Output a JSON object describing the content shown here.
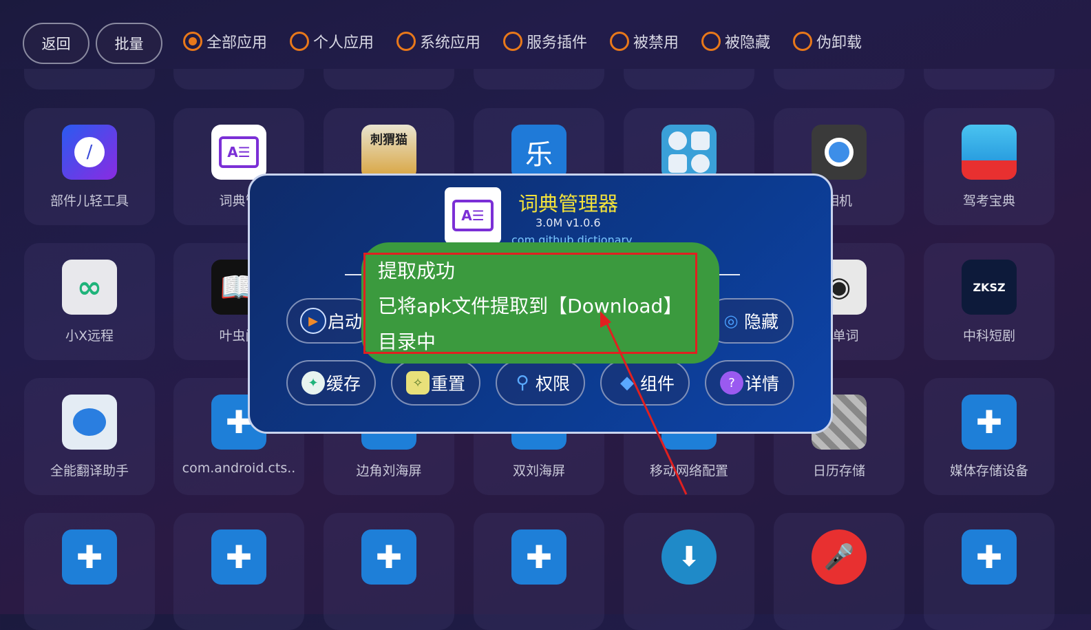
{
  "topbar": {
    "back_label": "返回",
    "batch_label": "批量",
    "filters": [
      {
        "label": "全部应用",
        "selected": true
      },
      {
        "label": "个人应用",
        "selected": false
      },
      {
        "label": "系统应用",
        "selected": false
      },
      {
        "label": "服务插件",
        "selected": false
      },
      {
        "label": "被禁用",
        "selected": false
      },
      {
        "label": "被隐藏",
        "selected": false
      },
      {
        "label": "伪卸载",
        "selected": false
      }
    ]
  },
  "grid": {
    "row2": [
      "部件儿轻工具",
      "词典管",
      "",
      "",
      "",
      "相机",
      "驾考宝典"
    ],
    "row3": [
      "小X远程",
      "叶虫阅",
      "",
      "",
      "",
      "背单词",
      "中科短剧"
    ],
    "row4": [
      "全能翻译助手",
      "com.android.cts..",
      "边角刘海屏",
      "双刘海屏",
      "移动网络配置",
      "日历存储",
      "媒体存储设备"
    ]
  },
  "dialog": {
    "app_name": "词典管理器",
    "meta": "3.0M  v1.0.6",
    "package": "com.github.dictionary",
    "buttons_row1": {
      "launch": "启动",
      "hide": "隐藏"
    },
    "buttons_row2": [
      "缓存",
      "重置",
      "权限",
      "组件",
      "详情"
    ]
  },
  "toast": {
    "line1": "提取成功",
    "line2": "已将apk文件提取到【Download】",
    "line3": "目录中"
  },
  "colors": {
    "accent": "#e8781a",
    "toast_bg": "#3b9a3e",
    "highlight": "#e02020",
    "title_yellow": "#f3e23a"
  }
}
